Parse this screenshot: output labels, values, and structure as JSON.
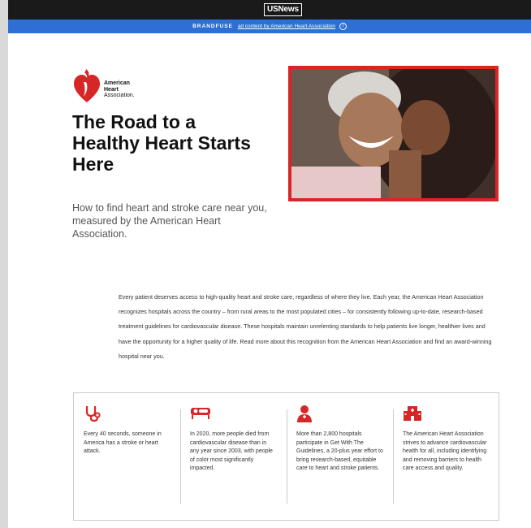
{
  "topbar": {
    "brand": "USNews"
  },
  "adbar": {
    "label": "BRANDFUSE",
    "link_text": "ad content by American Heart Association",
    "info": "i"
  },
  "logo": {
    "line1": "American",
    "line2": "Heart",
    "line3": "Association."
  },
  "hero": {
    "headline": "The Road to a Healthy Heart Starts Here",
    "subtitle": "How to find heart and stroke care near you, measured by the American Heart Association."
  },
  "intro": "Every patient deserves access to high-quality heart and stroke care, regardless of where they live. Each year, the American Heart Association recognizes hospitals across the country – from rural areas to the most populated cities – for consistently following up-to-date, research-based treatment guidelines for cardiovascular disease. These hospitals maintain unrelenting standards to help patients live longer, healthier lives and have the opportunity for a higher quality of life. Read more about this recognition from the American Heart Association and find an award-winning hospital near you.",
  "stats": [
    {
      "icon": "stethoscope-icon",
      "text": "Every 40 seconds, someone in America has a stroke or heart attack."
    },
    {
      "icon": "patient-bed-icon",
      "text": "In 2020, more people died from cardiovascular disease than in any year since 2003, with people of color most significantly impacted."
    },
    {
      "icon": "doctor-icon",
      "text": "More than 2,800 hospitals participate in Get With The Guidelines, a 20-plus year effort to bring research-based, equitable care to heart and stroke patients."
    },
    {
      "icon": "hospital-icon",
      "text": "The American Heart Association strives to advance cardiovascular health for all, including identifying and removing barriers to health care access and quality."
    }
  ],
  "colors": {
    "accent": "#d72626",
    "adbar": "#2e6fd6",
    "topbar": "#1a1a1a"
  }
}
